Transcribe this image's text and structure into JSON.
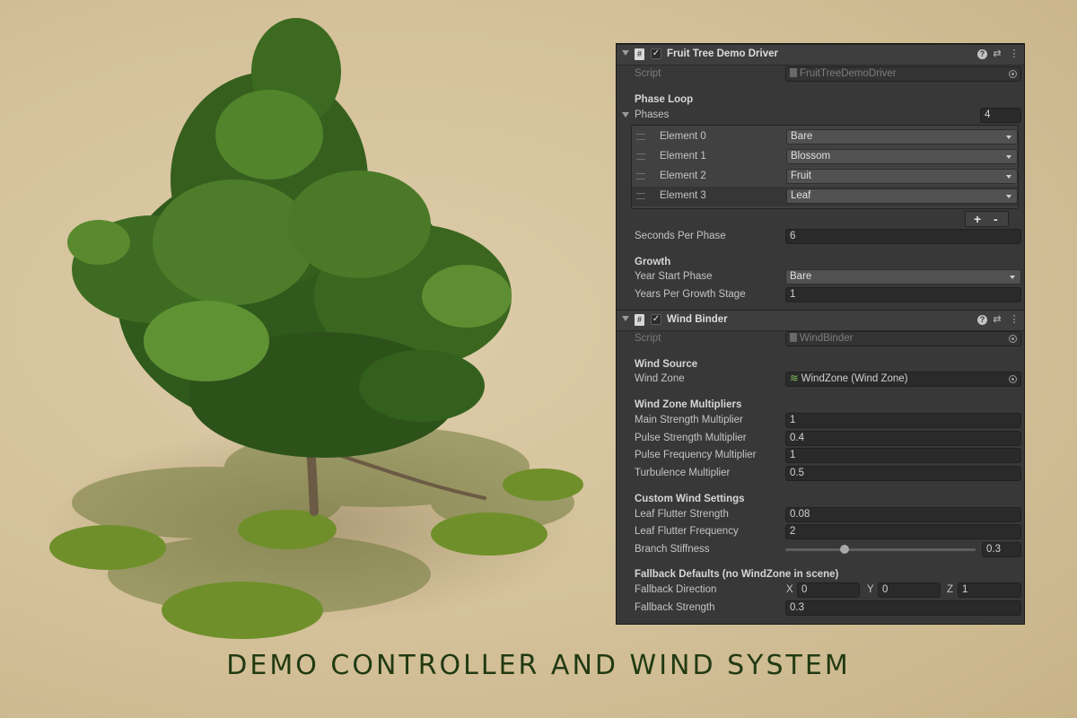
{
  "caption": "DEMO CONTROLLER AND WIND SYSTEM",
  "colors": {
    "panel_bg": "#383838",
    "header_bg": "#3e3e3e",
    "caption": "#213a12",
    "background": "#d4c19a"
  },
  "fruit_tree_demo_driver": {
    "title": "Fruit Tree Demo Driver",
    "script_label": "Script",
    "script_value": "FruitTreeDemoDriver",
    "phase_loop_header": "Phase Loop",
    "phases_label": "Phases",
    "phases_count": "4",
    "elements": [
      {
        "label": "Element 0",
        "value": "Bare"
      },
      {
        "label": "Element 1",
        "value": "Blossom"
      },
      {
        "label": "Element 2",
        "value": "Fruit"
      },
      {
        "label": "Element 3",
        "value": "Leaf"
      }
    ],
    "plus": "+",
    "minus": "-",
    "seconds_per_phase_label": "Seconds Per Phase",
    "seconds_per_phase": "6",
    "growth_header": "Growth",
    "year_start_phase_label": "Year Start Phase",
    "year_start_phase": "Bare",
    "years_per_growth_stage_label": "Years Per Growth Stage",
    "years_per_growth_stage": "1"
  },
  "wind_binder": {
    "title": "Wind Binder",
    "script_label": "Script",
    "script_value": "WindBinder",
    "wind_source_header": "Wind Source",
    "wind_zone_label": "Wind Zone",
    "wind_zone_value": "WindZone (Wind Zone)",
    "multipliers_header": "Wind Zone Multipliers",
    "main_strength_label": "Main Strength Multiplier",
    "main_strength": "1",
    "pulse_strength_label": "Pulse Strength Multiplier",
    "pulse_strength": "0.4",
    "pulse_frequency_label": "Pulse Frequency Multiplier",
    "pulse_frequency": "1",
    "turbulence_label": "Turbulence Multiplier",
    "turbulence": "0.5",
    "custom_header": "Custom Wind Settings",
    "leaf_flutter_strength_label": "Leaf Flutter Strength",
    "leaf_flutter_strength": "0.08",
    "leaf_flutter_frequency_label": "Leaf Flutter Frequency",
    "leaf_flutter_frequency": "2",
    "branch_stiffness_label": "Branch Stiffness",
    "branch_stiffness": "0.3",
    "fallback_header": "Fallback Defaults (no WindZone in scene)",
    "fallback_direction_label": "Fallback Direction",
    "x_label": "X",
    "x_value": "0",
    "y_label": "Y",
    "y_value": "0",
    "z_label": "Z",
    "z_value": "1",
    "fallback_strength_label": "Fallback Strength",
    "fallback_strength": "0.3"
  },
  "icons": [
    "foldout-arrow-icon",
    "script-icon",
    "checkbox-icon",
    "help-icon",
    "preset-icon",
    "kebab-menu-icon",
    "object-picker-icon",
    "dropdown-arrow-icon",
    "drag-handle-icon",
    "wind-zone-icon"
  ]
}
